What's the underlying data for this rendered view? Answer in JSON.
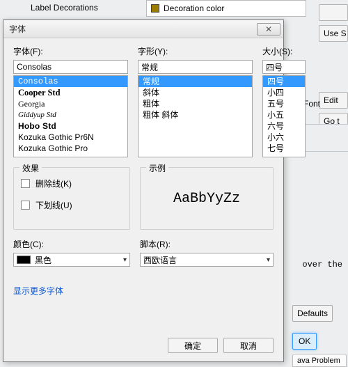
{
  "bg": {
    "tree_item": "Label Decorations",
    "decor_label": "Decoration color",
    "buttons": {
      "use": "Use S",
      "edit": "Edit",
      "go": "Go t"
    },
    "font_label": "Font",
    "over_text": "over the",
    "defaults": "Defaults",
    "ok": "OK",
    "tab": "ava Problem"
  },
  "dialog": {
    "title": "字体",
    "labels": {
      "font": "字体(F):",
      "style": "字形(Y):",
      "size": "大小(S):",
      "effects": "效果",
      "sample": "示例",
      "color": "颜色(C):",
      "script": "脚本(R):"
    },
    "font_input": "Consolas",
    "style_input": "常规",
    "size_input": "四号",
    "font_list": [
      "Consolas",
      "Cooper Std",
      "Georgia",
      "Giddyup Std",
      "Hobo Std",
      "Kozuka Gothic Pr6N",
      "Kozuka Gothic Pro"
    ],
    "style_list": [
      "常规",
      "斜体",
      "粗体",
      "粗体 斜体"
    ],
    "size_list": [
      "四号",
      "小四",
      "五号",
      "小五",
      "六号",
      "小六",
      "七号"
    ],
    "effects": {
      "strike": "删除线(K)",
      "underline": "下划线(U)"
    },
    "sample_text": "AaBbYyZz",
    "color_value": "黑色",
    "script_value": "西欧语言",
    "more_link": "显示更多字体",
    "ok": "确定",
    "cancel": "取消"
  }
}
